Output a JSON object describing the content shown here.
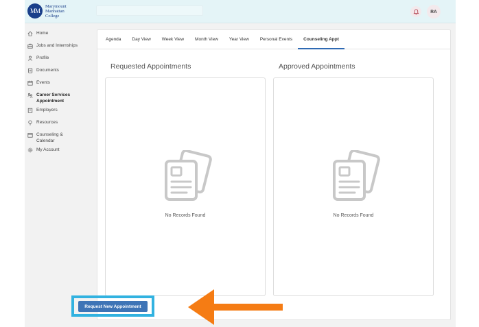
{
  "logo": {
    "initials": "MM",
    "line1": "Marymount",
    "line2": "Manhattan",
    "line3": "College"
  },
  "header": {
    "user_initials": "RA"
  },
  "sidebar": {
    "items": [
      {
        "label_1": "Home",
        "label_2": "",
        "icon": "home-icon"
      },
      {
        "label_1": "Jobs and Internships",
        "label_2": "",
        "icon": "briefcase-icon"
      },
      {
        "label_1": "Profile",
        "label_2": "",
        "icon": "user-icon"
      },
      {
        "label_1": "Documents",
        "label_2": "",
        "icon": "document-icon"
      },
      {
        "label_1": "Events",
        "label_2": "",
        "icon": "calendar-icon"
      },
      {
        "label_1": "Career Services",
        "label_2": "Appointment",
        "icon": "people-icon"
      },
      {
        "label_1": "Employers",
        "label_2": "",
        "icon": "building-icon"
      },
      {
        "label_1": "Resources",
        "label_2": "",
        "icon": "lightbulb-icon"
      },
      {
        "label_1": "Counseling &",
        "label_2": "Calendar",
        "icon": "calendar-icon"
      },
      {
        "label_1": "My Account",
        "label_2": "",
        "icon": "gear-icon"
      }
    ]
  },
  "tabs": [
    {
      "label": "Agenda"
    },
    {
      "label": "Day View"
    },
    {
      "label": "Week View"
    },
    {
      "label": "Month View"
    },
    {
      "label": "Year View"
    },
    {
      "label": "Personal Events"
    },
    {
      "label": "Counseling Appt"
    }
  ],
  "requested": {
    "title": "Requested Appointments",
    "empty": "No Records Found"
  },
  "approved": {
    "title": "Approved Appointments",
    "empty": "No Records Found"
  },
  "actions": {
    "request_label": "Request New Appointment"
  },
  "colors": {
    "accent": "#3e74b6",
    "highlight": "#32b2e0",
    "arrow": "#f57c14",
    "topbar": "#e4f4f7"
  }
}
